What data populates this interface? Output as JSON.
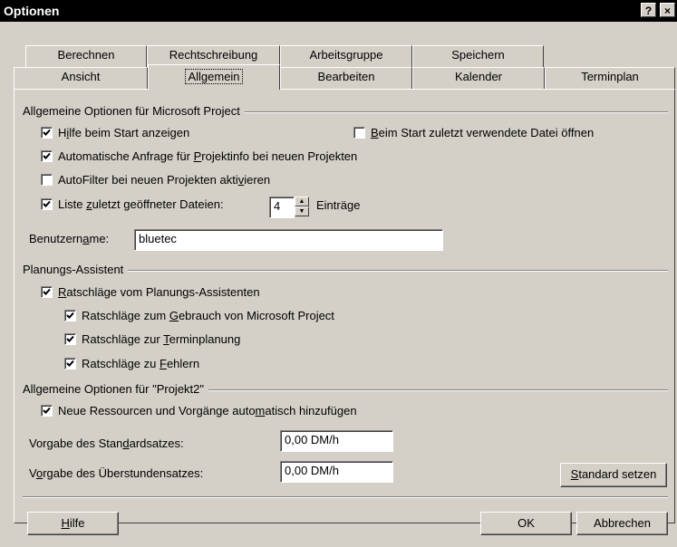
{
  "window": {
    "title": "Optionen",
    "help_btn": "?",
    "close_btn": "×"
  },
  "tabs": {
    "row_back": [
      "Berechnen",
      "Rechtschreibung",
      "Arbeitsgruppe",
      "Speichern"
    ],
    "row_front": [
      "Ansicht",
      "Allgemein",
      "Bearbeiten",
      "Kalender",
      "Terminplan"
    ],
    "active": "Allgemein"
  },
  "general": {
    "group_title": "Allgemeine Optionen für Microsoft Project",
    "help_on_start": {
      "label_pre": "H",
      "label_ul": "i",
      "label_post": "lfe beim Start anzeigen",
      "checked": true
    },
    "open_last_file": {
      "label_pre": "",
      "label_ul": "B",
      "label_post": "eim Start zuletzt verwendete Datei öffnen",
      "checked": false
    },
    "auto_projinfo": {
      "label_pre": "Automatische Anfrage für ",
      "label_ul": "P",
      "label_post": "rojektinfo bei neuen Projekten",
      "checked": true
    },
    "autofilter": {
      "label_pre": "AutoFilter bei neuen Projekten akti",
      "label_ul": "v",
      "label_post": "ieren",
      "checked": false
    },
    "recent_files": {
      "label_pre": "Liste ",
      "label_ul": "z",
      "label_post": "uletzt geöffneter Dateien:",
      "checked": true,
      "value": "4",
      "suffix": "Einträge"
    },
    "username": {
      "label_pre": "Benutzern",
      "label_ul": "a",
      "label_post": "me:",
      "value": "bluetec"
    }
  },
  "planning": {
    "group_title": "Planungs-Assistent",
    "advice": {
      "label_pre": "",
      "label_ul": "R",
      "label_post": "atschläge vom Planungs-Assistenten",
      "checked": true
    },
    "usage": {
      "label_pre": "Ratschläge zum ",
      "label_ul": "G",
      "label_post": "ebrauch von Microsoft Project",
      "checked": true
    },
    "scheduling": {
      "label_pre": "Ratschläge zur ",
      "label_ul": "T",
      "label_post": "erminplanung",
      "checked": true
    },
    "errors": {
      "label_pre": "Ratschläge zu ",
      "label_ul": "F",
      "label_post": "ehlern",
      "checked": true
    }
  },
  "project": {
    "group_title": "Allgemeine Optionen für \"Projekt2\"",
    "auto_add": {
      "label_pre": "Neue Ressourcen und Vorgänge auto",
      "label_ul": "m",
      "label_post": "atisch hinzufügen",
      "checked": true
    },
    "std_rate": {
      "label_pre": "Vorgabe des Stan",
      "label_ul": "d",
      "label_post": "ardsatzes:",
      "value": "0,00 DM/h"
    },
    "ot_rate": {
      "label_pre": "V",
      "label_ul": "o",
      "label_post": "rgabe des Überstundensatzes:",
      "value": "0,00 DM/h"
    },
    "set_default": {
      "label_pre": "",
      "label_ul": "S",
      "label_post": "tandard setzen"
    }
  },
  "buttons": {
    "help": {
      "label_pre": "",
      "label_ul": "H",
      "label_post": "ilfe"
    },
    "ok": "OK",
    "cancel": "Abbrechen"
  }
}
